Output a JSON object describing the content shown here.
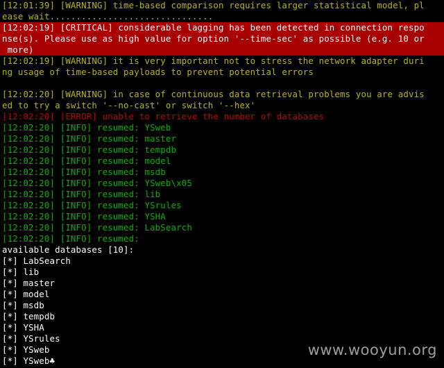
{
  "terminal": {
    "colors": {
      "background": "#000000",
      "warning": "#b8b800",
      "critical_text": "#ffffff",
      "critical_background": "#a80000",
      "error": "#c40000",
      "info": "#00b400",
      "output": "#ffffff"
    },
    "lines": [
      "[12:01:39] [WARNING] time-based comparison requires larger statistical model, pl",
      "ease wait...............................",
      "[12:02:19] [CRITICAL] considerable lagging has been detected in connection respo",
      "nse(s). Please use as high value for option '--time-sec' as possible (e.g. 10 or",
      " more)",
      "[12:02:19] [WARNING] it is very important not to stress the network adapter duri",
      "ng usage of time-based payloads to prevent potential errors",
      "",
      "[12:02:20] [WARNING] in case of continuous data retrieval problems you are advis",
      "ed to try a switch '--no-cast' or switch '--hex'",
      "[12:02:20] [ERROR] unable to retrieve the number of databases",
      "[12:02:20] [INFO] resumed: YSweb",
      "[12:02:20] [INFO] resumed: master",
      "[12:02:20] [INFO] resumed: tempdb",
      "[12:02:20] [INFO] resumed: model",
      "[12:02:20] [INFO] resumed: msdb",
      "[12:02:20] [INFO] resumed: YSweb\\x05",
      "[12:02:20] [INFO] resumed: lib",
      "[12:02:20] [INFO] resumed: YSrules",
      "[12:02:20] [INFO] resumed: YSHA",
      "[12:02:20] [INFO] resumed: LabSearch",
      "[12:02:20] [INFO] resumed:",
      "available databases [10]:",
      "[*] LabSearch",
      "[*] lib",
      "[*] master",
      "[*] model",
      "[*] msdb",
      "[*] tempdb",
      "[*] YSHA",
      "[*] YSrules",
      "[*] YSweb",
      "[*] YSweb♣"
    ]
  },
  "watermark": {
    "text": "www.wooyun.org"
  }
}
